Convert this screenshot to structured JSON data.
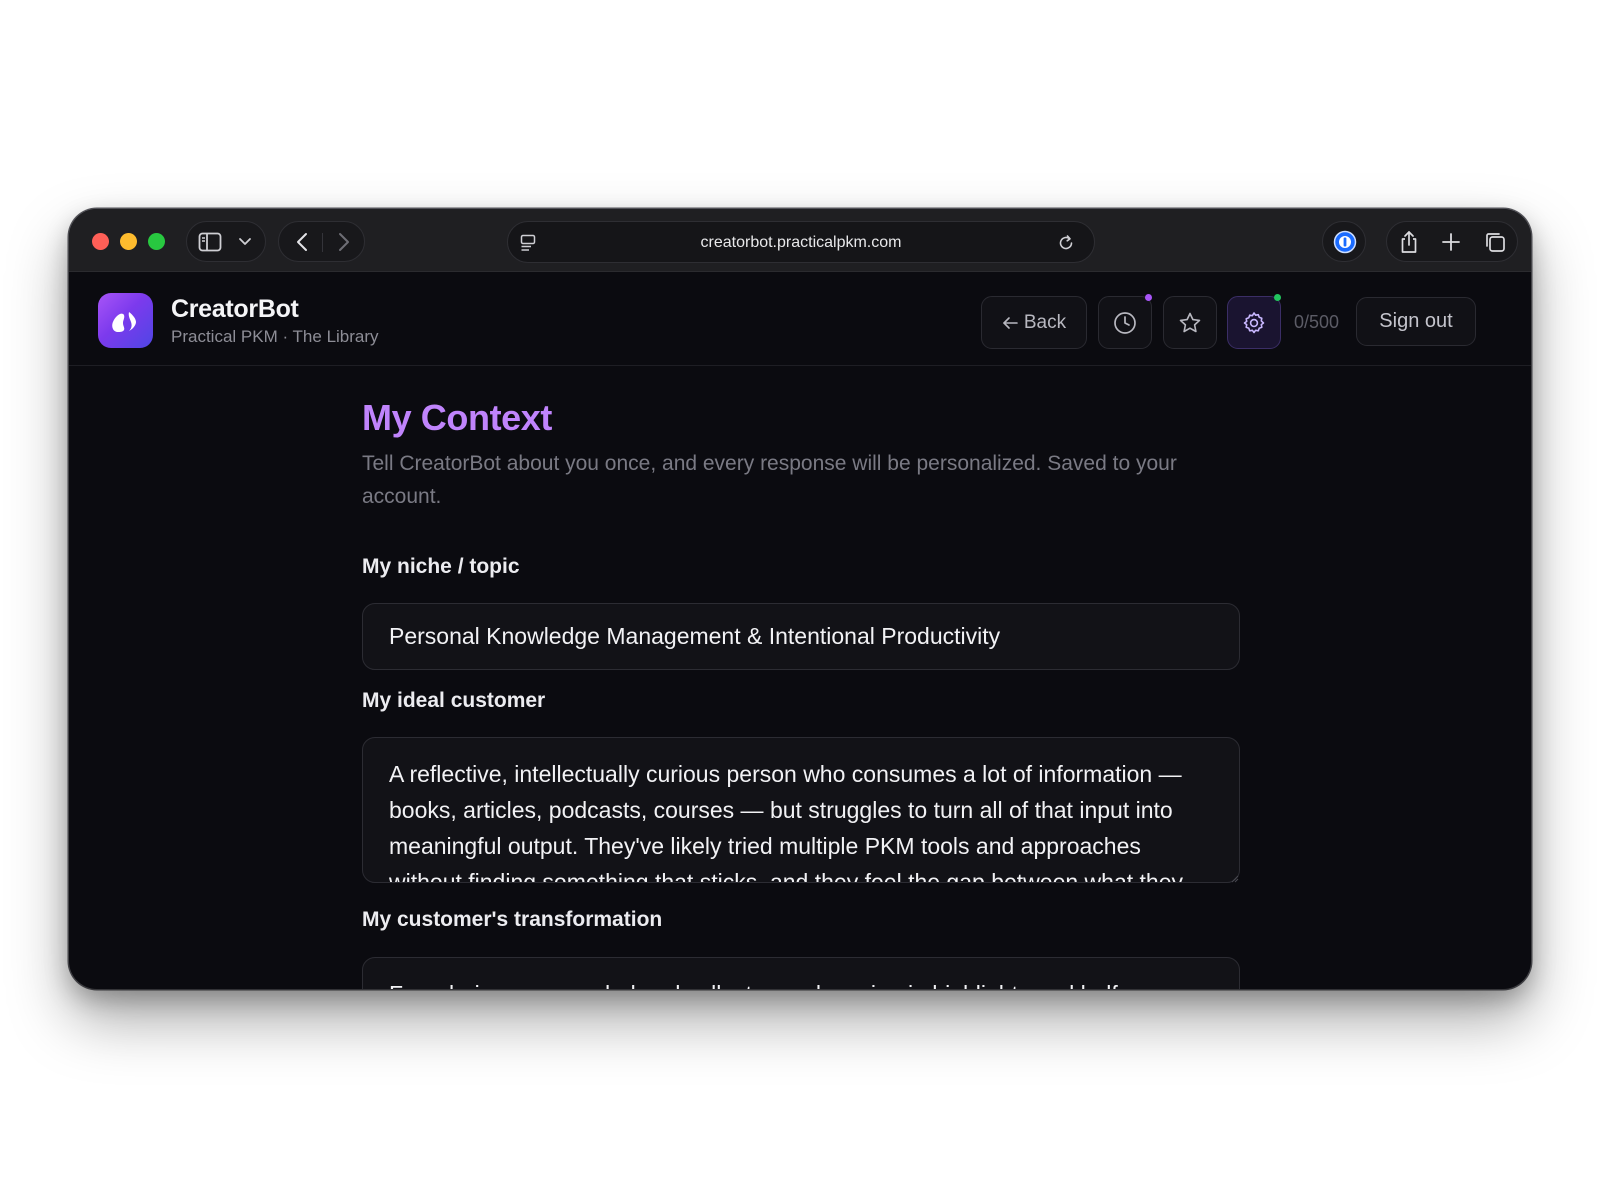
{
  "browser": {
    "url": "creatorbot.practicalpkm.com",
    "icons": {
      "sidebar": "sidebar-toggle-icon",
      "chevron": "chevron-down-icon",
      "back": "chevron-left-icon",
      "forward": "chevron-right-icon",
      "site": "site-settings-icon",
      "reload": "reload-icon",
      "password": "password-manager-icon",
      "share": "share-icon",
      "new_tab": "plus-icon",
      "tabs": "tab-overview-icon"
    }
  },
  "header": {
    "brand": "CreatorBot",
    "subtitle": "Practical PKM · The Library",
    "back_label": "Back",
    "counter": "0/500",
    "signout_label": "Sign out",
    "icons": {
      "logo": "creatorbot-logo-icon",
      "back": "arrow-left-icon",
      "history": "clock-icon",
      "favorites": "star-icon",
      "settings": "gear-icon"
    },
    "history_dot_color": "#a855f7",
    "settings_dot_color": "#22c55e"
  },
  "page": {
    "title": "My Context",
    "description": "Tell CreatorBot about you once, and every response will be personalized. Saved to your account.",
    "fields": {
      "niche": {
        "label": "My niche / topic",
        "value": "Personal Knowledge Management & Intentional Productivity"
      },
      "customer": {
        "label": "My ideal customer",
        "value": "A reflective, intellectually curious person who consumes a lot of information — books, articles, podcasts, courses — but struggles to turn all of that input into meaningful output. They've likely tried multiple PKM tools and approaches without finding something that sticks, and they feel the gap between what they"
      },
      "transformation": {
        "label": "My customer's transformation",
        "value": "From being an overwhelmed collector — drowning in highlights and half-"
      }
    }
  },
  "colors": {
    "accent": "#c084fc",
    "background": "#0b0b10",
    "logo_gradient_start": "#a855f7",
    "logo_gradient_end": "#4f46e5"
  }
}
